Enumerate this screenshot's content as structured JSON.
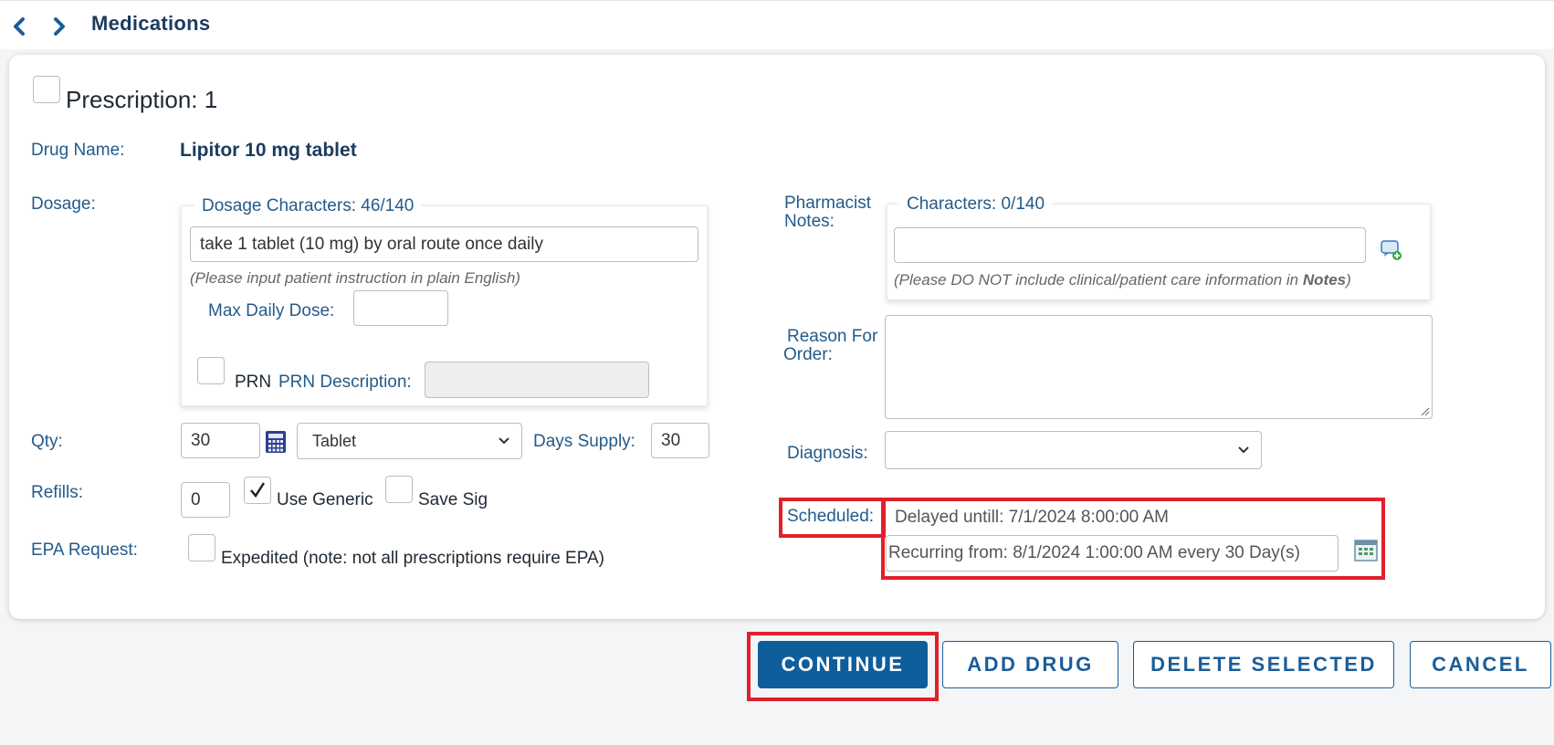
{
  "header": {
    "title": "Medications"
  },
  "prescription": {
    "title": "Prescription: 1",
    "drug_name_label": "Drug Name:",
    "drug_name": "Lipitor 10 mg tablet",
    "dosage_label": "Dosage:",
    "dosage_legend": "Dosage Characters: 46/140",
    "dosage_value": "take 1 tablet (10 mg) by oral route once daily",
    "dosage_hint": "(Please input patient instruction in plain English)",
    "max_daily_dose_label": "Max Daily Dose:",
    "max_daily_dose_value": "",
    "prn_label": "PRN",
    "prn_description_label": "PRN Description:",
    "prn_description_value": "",
    "qty_label": "Qty:",
    "qty_value": "30",
    "unit_value": "Tablet",
    "days_supply_label": "Days Supply:",
    "days_supply_value": "30",
    "refills_label": "Refills:",
    "refills_value": "0",
    "use_generic_label": "Use Generic",
    "use_generic_checked": true,
    "save_sig_label": "Save Sig",
    "epa_label": "EPA Request:",
    "epa_option_label": "Expedited (note: not all prescriptions require EPA)",
    "pharmacist_notes_label_1": "Pharmacist",
    "pharmacist_notes_label_2": "Notes:",
    "pharmacist_notes_legend": "Characters: 0/140",
    "pharmacist_notes_value": "",
    "pharmacist_notes_hint_prefix": "(Please DO NOT include clinical/patient care information in ",
    "pharmacist_notes_hint_bold": "Notes",
    "pharmacist_notes_hint_suffix": ")",
    "reason_label_1": "Reason For",
    "reason_label_2": "Order:",
    "reason_value": "",
    "diagnosis_label": "Diagnosis:",
    "diagnosis_value": "",
    "scheduled_label": "Scheduled:",
    "scheduled_delayed": "Delayed untill: 7/1/2024 8:00:00 AM",
    "scheduled_recurring": "Recurring from: 8/1/2024 1:00:00 AM every 30 Day(s)"
  },
  "actions": {
    "continue": "CONTINUE",
    "add_drug": "ADD DRUG",
    "delete_selected": "DELETE SELECTED",
    "cancel": "CANCEL"
  },
  "colors": {
    "accent": "#0f5e9c",
    "label": "#245b8a",
    "highlight": "#e0202a"
  },
  "icons": [
    "back-arrow-icon",
    "forward-arrow-icon",
    "calculator-icon",
    "add-note-icon",
    "calendar-schedule-icon",
    "chevron-down-icon",
    "checkmark-icon",
    "resize-grip-icon"
  ]
}
